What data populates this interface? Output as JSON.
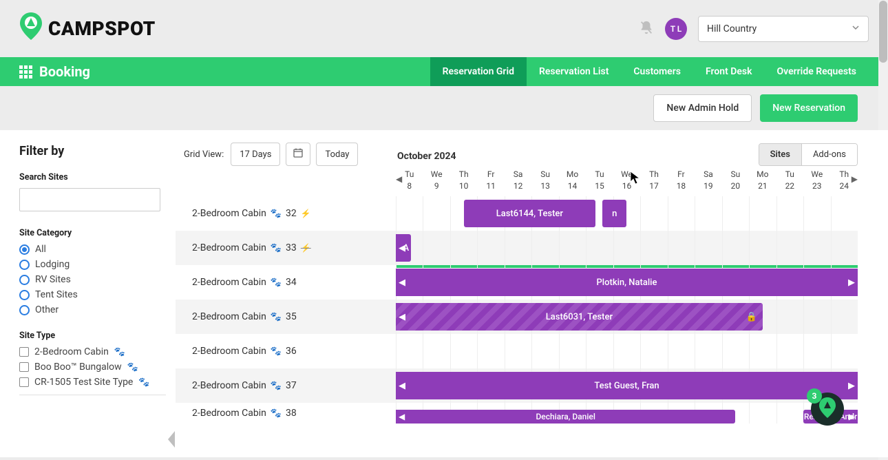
{
  "header": {
    "brand": "CAMPSPOT",
    "avatar_initials": "T L",
    "park_name": "Hill Country"
  },
  "nav": {
    "title": "Booking",
    "items": [
      "Reservation Grid",
      "Reservation List",
      "Customers",
      "Front Desk",
      "Override Requests"
    ],
    "active": 0
  },
  "actions": {
    "admin_hold": "New Admin Hold",
    "new_reservation": "New Reservation"
  },
  "sidebar": {
    "title": "Filter by",
    "search_label": "Search Sites",
    "category_label": "Site Category",
    "categories": [
      "All",
      "Lodging",
      "RV Sites",
      "Tent Sites",
      "Other"
    ],
    "category_selected": 0,
    "type_label": "Site Type",
    "types": [
      "2-Bedroom Cabin",
      "Boo Boo™ Bungalow",
      "CR-1505 Test Site Type"
    ]
  },
  "grid": {
    "view_label": "Grid View:",
    "days_btn": "17 Days",
    "today_btn": "Today",
    "month": "October 2024",
    "segments": [
      "Sites",
      "Add-ons"
    ],
    "segment_active": 0,
    "days": [
      {
        "dow": "Tu",
        "num": "8"
      },
      {
        "dow": "We",
        "num": "9"
      },
      {
        "dow": "Th",
        "num": "10"
      },
      {
        "dow": "Fr",
        "num": "11"
      },
      {
        "dow": "Sa",
        "num": "12"
      },
      {
        "dow": "Su",
        "num": "13"
      },
      {
        "dow": "Mo",
        "num": "14"
      },
      {
        "dow": "Tu",
        "num": "15"
      },
      {
        "dow": "We",
        "num": "16"
      },
      {
        "dow": "Th",
        "num": "17"
      },
      {
        "dow": "Fr",
        "num": "18"
      },
      {
        "dow": "Sa",
        "num": "19"
      },
      {
        "dow": "Su",
        "num": "20"
      },
      {
        "dow": "Mo",
        "num": "21"
      },
      {
        "dow": "Tu",
        "num": "22"
      },
      {
        "dow": "We",
        "num": "23"
      },
      {
        "dow": "Th",
        "num": "24"
      }
    ],
    "rows": [
      {
        "name": "2-Bedroom Cabin",
        "num": "32",
        "paw": true,
        "bolt": true
      },
      {
        "name": "2-Bedroom Cabin",
        "num": "33",
        "paw": true,
        "bolt_off": true
      },
      {
        "name": "2-Bedroom Cabin",
        "num": "34",
        "paw": true
      },
      {
        "name": "2-Bedroom Cabin",
        "num": "35",
        "paw": true
      },
      {
        "name": "2-Bedroom Cabin",
        "num": "36",
        "paw": true
      },
      {
        "name": "2-Bedroom Cabin",
        "num": "37",
        "paw": true
      },
      {
        "name": "2-Bedroom Cabin",
        "num": "38",
        "paw": true
      }
    ],
    "bookings": {
      "b1": "Last6144, Tester",
      "b1b": "n",
      "b2": "A",
      "b3": "Plotkin, Natalie",
      "b4": "Last6031, Tester",
      "b5": "Test Guest, Fran",
      "b6": "Dechiara, Daniel",
      "b7": "Rezende, Andr"
    }
  },
  "fab": {
    "count": "3"
  }
}
